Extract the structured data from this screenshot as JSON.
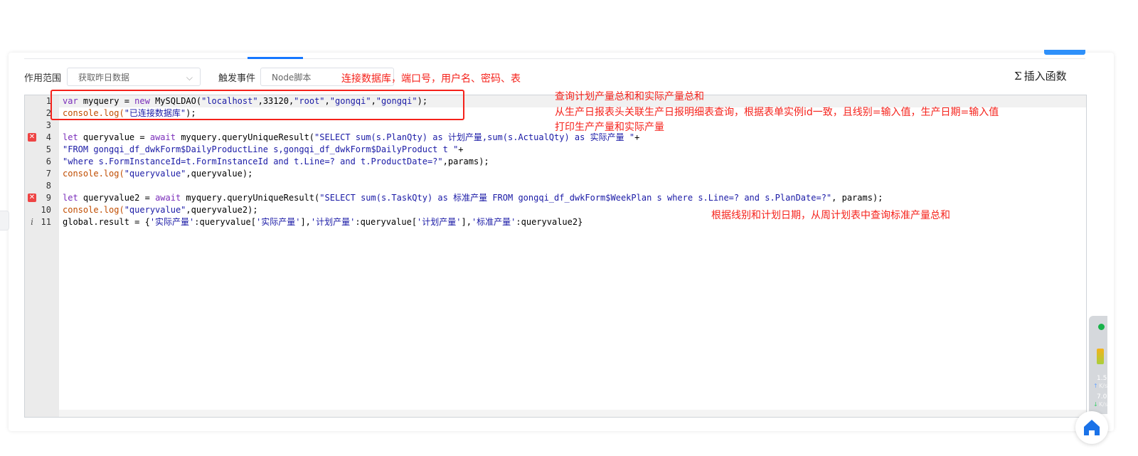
{
  "toolbar": {
    "scope_label": "作用范围",
    "scope_value": "获取昨日数据",
    "trigger_label": "触发事件",
    "trigger_value": "Node脚本",
    "insert_function_label": "插入函数",
    "insert_function_icon": "sigma-icon"
  },
  "editor": {
    "lines": [
      {
        "num": "1"
      },
      {
        "num": "2"
      },
      {
        "num": "3"
      },
      {
        "num": "4",
        "marker": "error"
      },
      {
        "num": "5"
      },
      {
        "num": "6"
      },
      {
        "num": "7"
      },
      {
        "num": "8"
      },
      {
        "num": "9",
        "marker": "error"
      },
      {
        "num": "10"
      },
      {
        "num": "11",
        "marker": "info"
      }
    ],
    "code": {
      "l1": {
        "a": "var",
        "b": " myquery = ",
        "c": "new",
        "d": " MySQLDAO(",
        "e": "\"localhost\"",
        "f": ",33120,",
        "g": "\"root\"",
        "h": ",",
        "i": "\"gongqi\"",
        "j": ",",
        "k": "\"gongqi\"",
        "l": ");"
      },
      "l2": {
        "a": "console",
        "b": ".log(",
        "c": "\"已连接数据库\"",
        "d": ");"
      },
      "l4": {
        "a": "let",
        "b": " queryvalue = ",
        "c": "await",
        "d": " myquery.queryUniqueResult(",
        "e": "\"SELECT sum(s.PlanQty) as 计划产量,sum(s.ActualQty) as 实际产量 \"",
        "f": "+"
      },
      "l5": {
        "a": "\"FROM gongqi_df_dwkForm$DailyProductLine s,gongqi_df_dwkForm$DailyProduct t \"",
        "b": "+"
      },
      "l6": {
        "a": "\"where s.FormInstanceId=t.FormInstanceId and t.Line=? and t.ProductDate=?\"",
        "b": ",params);"
      },
      "l7": {
        "a": "console",
        "b": ".log(",
        "c": "\"queryvalue\"",
        "d": ",queryvalue);"
      },
      "l9": {
        "a": "let",
        "b": " queryvalue2 = ",
        "c": "await",
        "d": " myquery.queryUniqueResult(",
        "e": "\"SELECT sum(s.TaskQty) as 标准产量 FROM gongqi_df_dwkForm$WeekPlan s where s.Line=? and s.PlanDate=?\"",
        "f": ", params);"
      },
      "l10": {
        "a": "console",
        "b": ".log(",
        "c": "\"queryvalue\"",
        "d": ",queryvalue2);"
      },
      "l11": {
        "a": "global.result = {",
        "b": "'实际产量'",
        "c": ":queryvalue[",
        "d": "'实际产量'",
        "e": "],",
        "f": "'计划产量'",
        "g": ":queryvalue[",
        "h": "'计划产量'",
        "i": "],",
        "j": "'标准产量'",
        "k": ":queryvalue2}"
      }
    }
  },
  "annotations": {
    "connect": "连接数据库，端口号，用户名、密码、表",
    "query1_l1": "查询计划产量总和和实际产量总和",
    "query1_l2": "从生产日报表头关联生产日报明细表查询，根据表单实例id一致，且线别=输入值，生产日期=输入值",
    "query1_l3": "打印生产产量和实际产量",
    "query2": "根据线别和计划日期，从周计划表中查询标准产量总和"
  },
  "widget": {
    "up_value": "1.5",
    "up_unit": "K/s",
    "down_value": "7.0",
    "down_unit": "K/s"
  },
  "colors": {
    "annotation": "#f5221b",
    "keyword": "#7a2dba",
    "string": "#1a1aa6",
    "accent": "#1677ff"
  }
}
